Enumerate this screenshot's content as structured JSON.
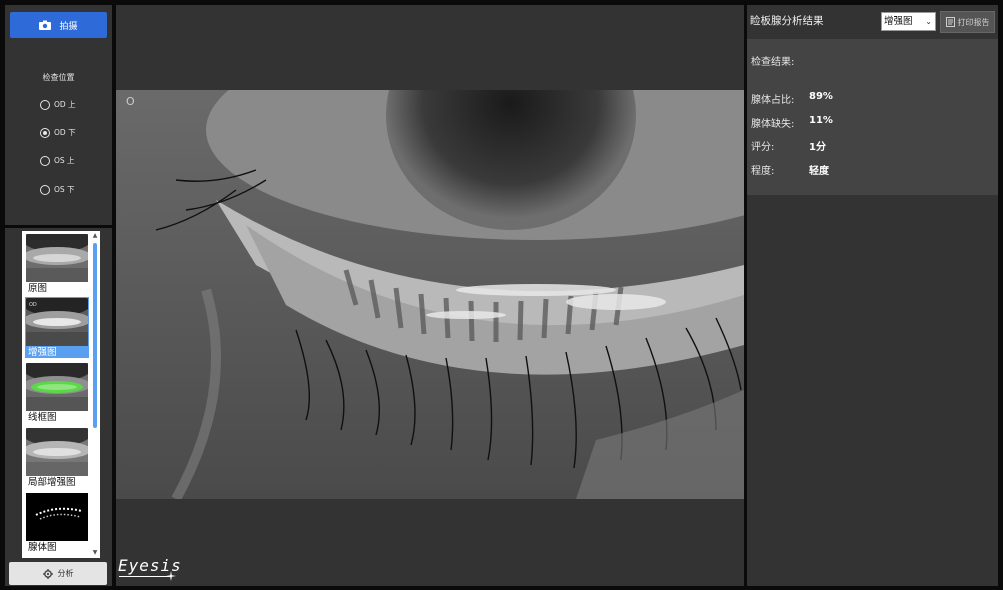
{
  "left": {
    "capture_label": "拍摄",
    "position_title": "检查位置",
    "positions": [
      {
        "label": "OD 上",
        "checked": false
      },
      {
        "label": "OD 下",
        "checked": true
      },
      {
        "label": "OS 上",
        "checked": false
      },
      {
        "label": "OS 下",
        "checked": false
      }
    ],
    "thumbs": [
      {
        "label": "原图",
        "selected": false
      },
      {
        "label": "增强图",
        "selected": true
      },
      {
        "label": "线框图",
        "selected": false
      },
      {
        "label": "局部增强图",
        "selected": false
      },
      {
        "label": "腺体图",
        "selected": false
      }
    ],
    "analyze_label": "分析"
  },
  "center": {
    "photo_marker": "O",
    "brand": "Eyesis"
  },
  "right": {
    "title": "睑板腺分析结果",
    "view_select": "增强图",
    "print_label": "打印报告",
    "result_title": "检查结果:",
    "rows": [
      {
        "label": "腺体占比:",
        "value": "89%"
      },
      {
        "label": "腺体缺失:",
        "value": "11%"
      },
      {
        "label": "评分:",
        "value": "1分"
      },
      {
        "label": "程度:",
        "value": "轻度"
      }
    ]
  },
  "colors": {
    "accent": "#2e6ad8",
    "selected": "#5aa0f0",
    "panel": "#333333",
    "overlay_green": "#5cd64a"
  }
}
